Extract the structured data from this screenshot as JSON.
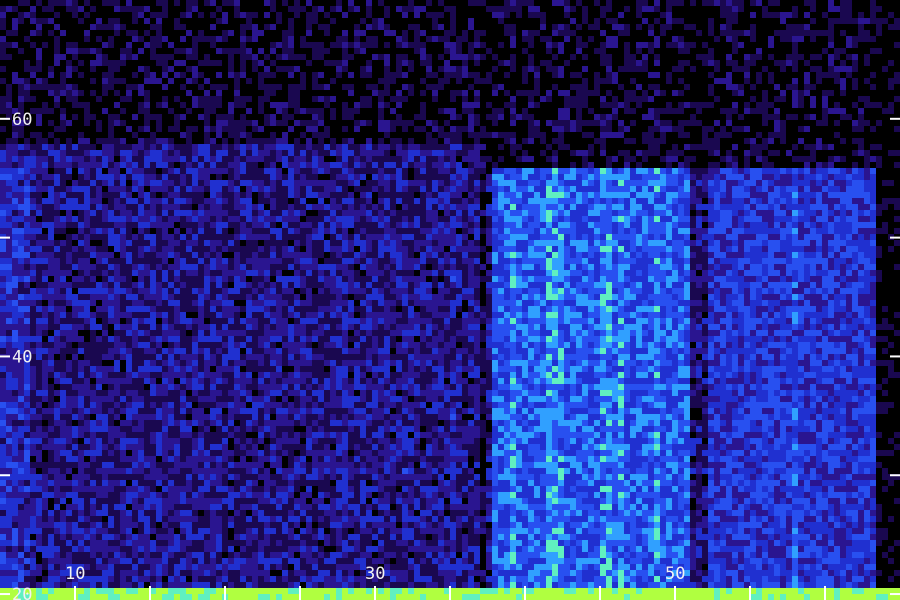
{
  "chart_data": {
    "type": "heatmap",
    "title": "",
    "xlabel": "",
    "ylabel": "",
    "background_color": "#1e0a55",
    "colormap": [
      "#000000",
      "#1a0850",
      "#2a1590",
      "#2030d0",
      "#2850f0",
      "#30a0ff",
      "#60f0c0",
      "#b0ff40"
    ],
    "tick_color": "#ffffff",
    "xlim": [
      5,
      65
    ],
    "ylim": [
      19.5,
      70
    ],
    "x_ticks": [
      10,
      15,
      20,
      25,
      30,
      35,
      40,
      45,
      50,
      55,
      60
    ],
    "x_tick_labels": [
      "10",
      "30",
      "50"
    ],
    "y_ticks": [
      20,
      30,
      40,
      50,
      60
    ],
    "y_tick_labels": [
      "20",
      "40",
      "60"
    ],
    "energy_regions": [
      {
        "x": [
          5,
          37.5
        ],
        "y": [
          20,
          58
        ],
        "level": 0.28
      },
      {
        "x": [
          5,
          7
        ],
        "y": [
          20,
          56
        ],
        "level": 0.4
      },
      {
        "x": [
          37.5,
          52
        ],
        "y": [
          20,
          56
        ],
        "level": 0.55
      },
      {
        "x": [
          52,
          63.5
        ],
        "y": [
          20,
          56
        ],
        "level": 0.45
      },
      {
        "x": [
          5,
          65
        ],
        "y": [
          19.5,
          20.3
        ],
        "level": 0.95
      }
    ],
    "quiet_gaps": [
      {
        "x": [
          37,
          37.8
        ]
      },
      {
        "x": [
          51,
          52
        ]
      },
      {
        "x": [
          63.5,
          65
        ]
      }
    ]
  }
}
